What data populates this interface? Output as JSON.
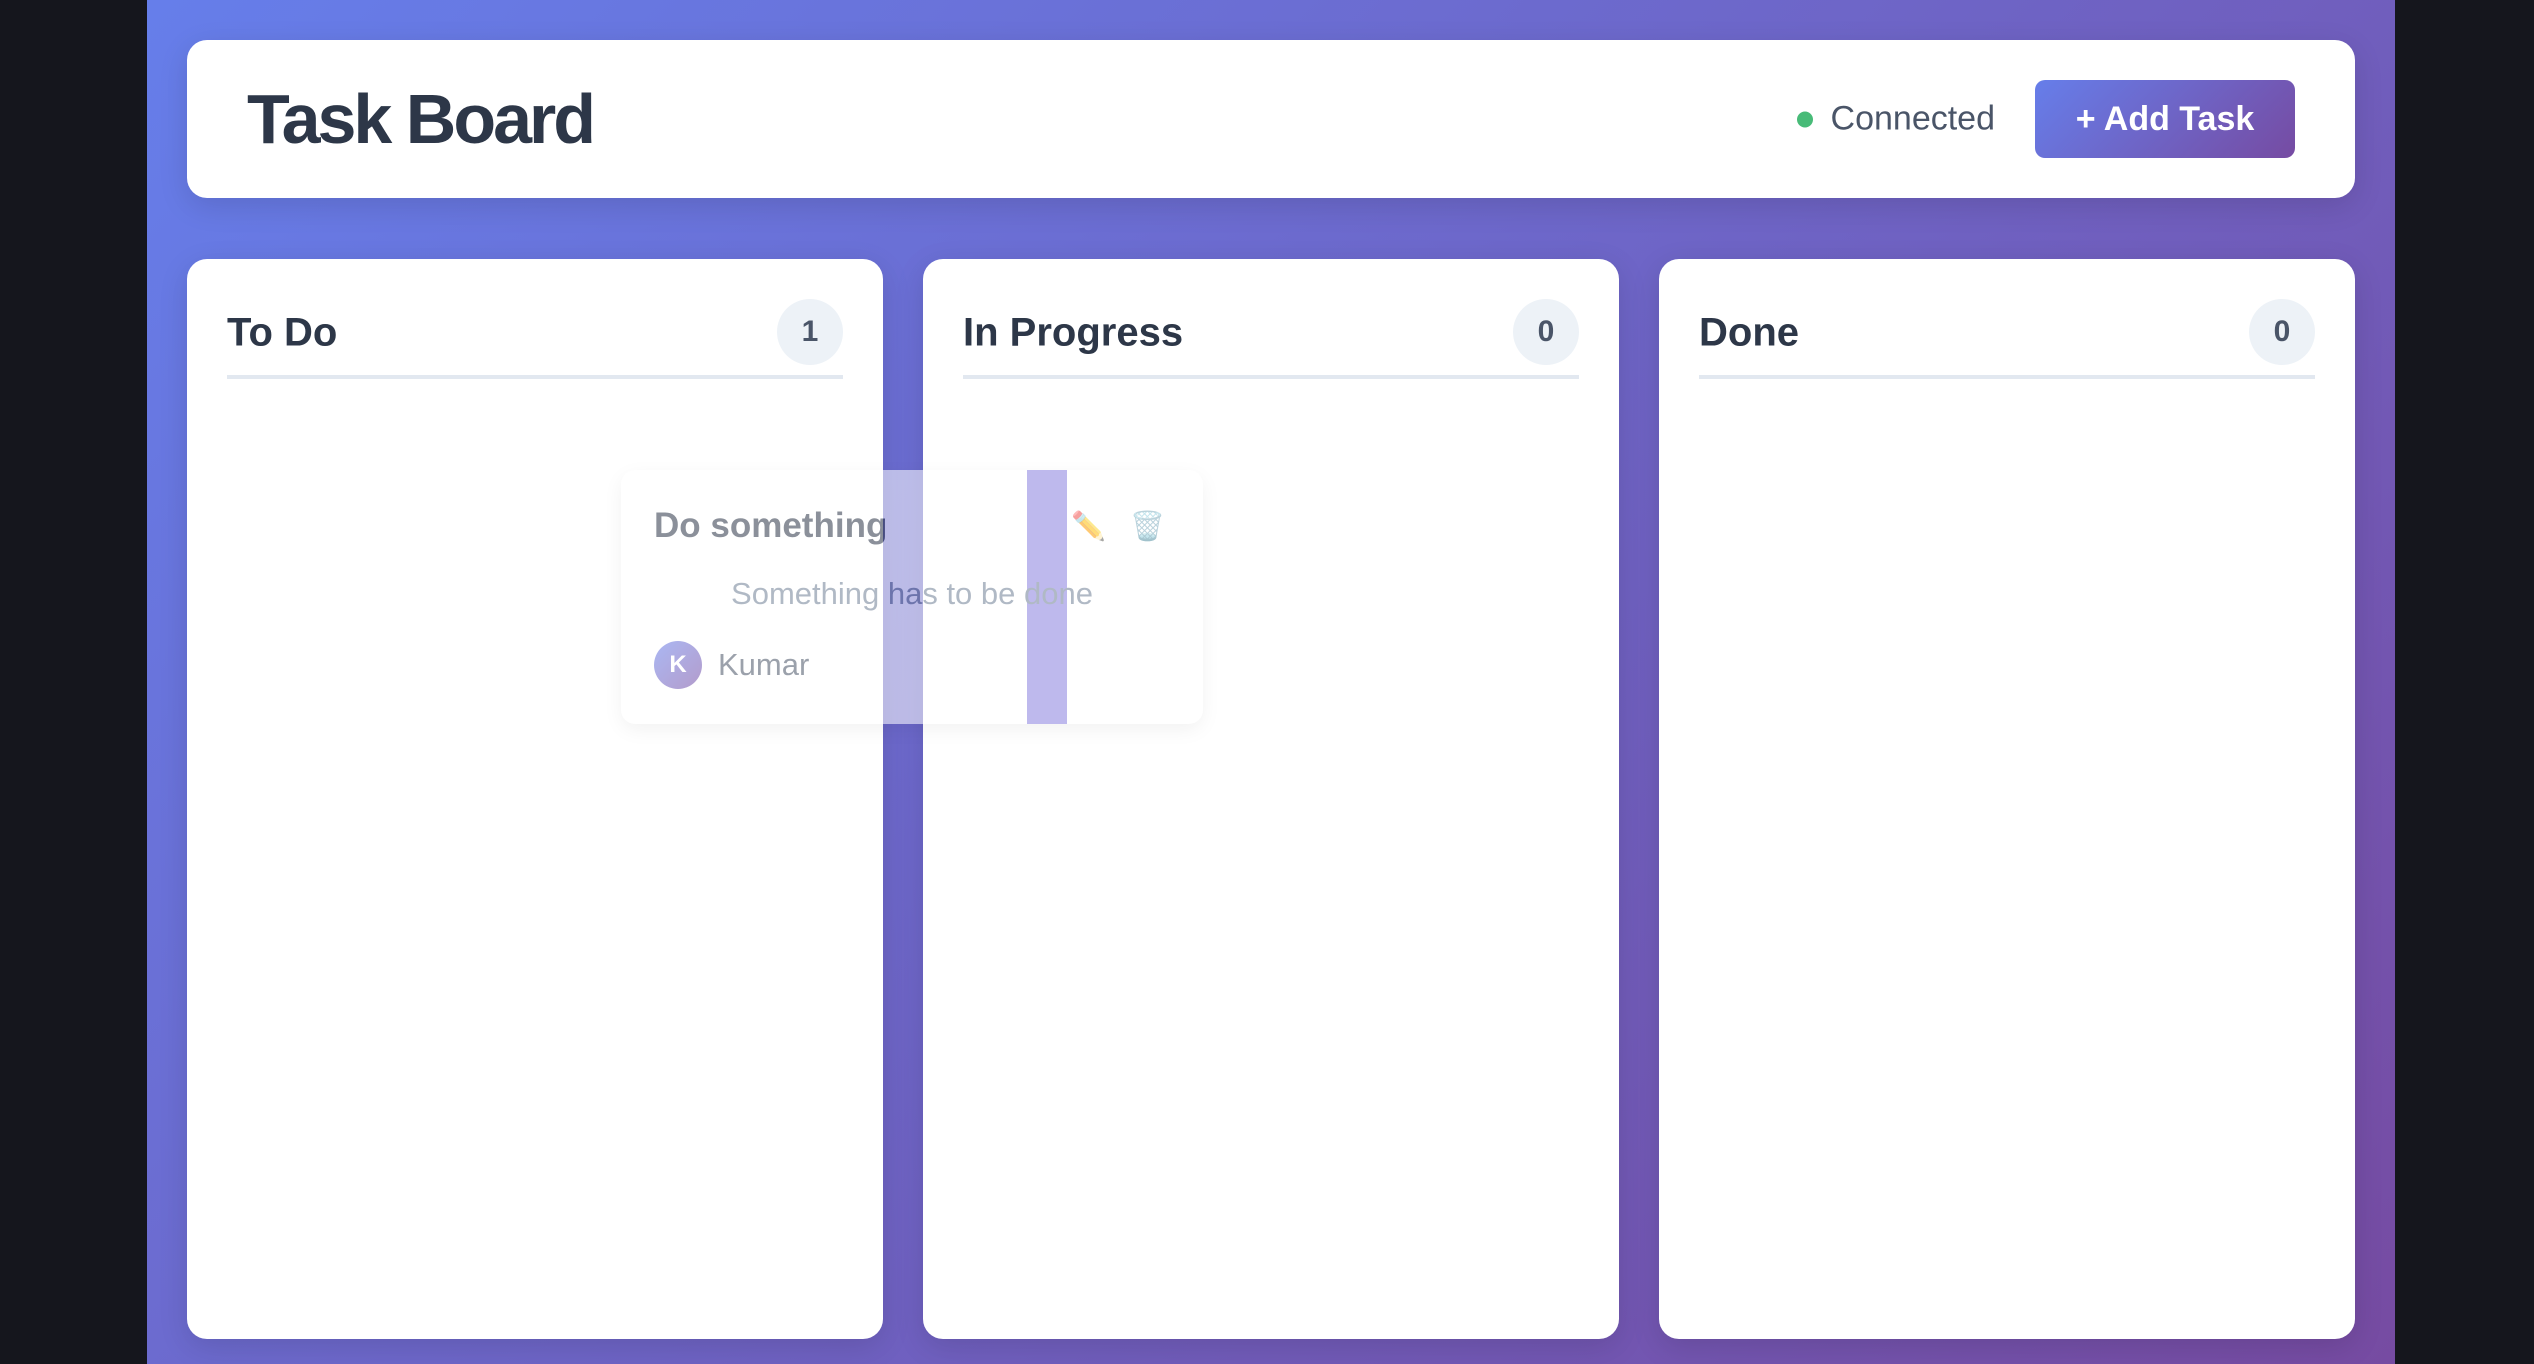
{
  "header": {
    "title": "Task Board",
    "status": "Connected",
    "add_button": "+ Add Task"
  },
  "columns": [
    {
      "title": "To Do",
      "count": "1"
    },
    {
      "title": "In Progress",
      "count": "0"
    },
    {
      "title": "Done",
      "count": "0"
    }
  ],
  "dragged_task": {
    "title": "Do something",
    "description": "Something has to be done",
    "assignee": "Kumar",
    "avatar_initial": "K",
    "edit_icon": "✏️",
    "delete_icon": "🗑️"
  },
  "colors": {
    "gradient_start": "#667eea",
    "gradient_end": "#764ba2",
    "status_connected": "#48bb78"
  }
}
